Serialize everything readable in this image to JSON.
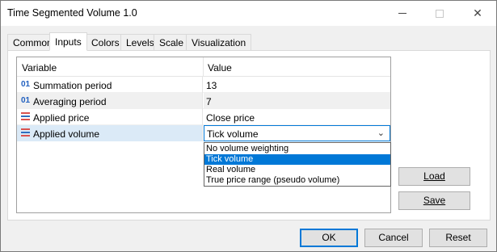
{
  "window": {
    "title": "Time Segmented Volume 1.0"
  },
  "tabs": [
    {
      "label": "Common"
    },
    {
      "label": "Inputs"
    },
    {
      "label": "Colors"
    },
    {
      "label": "Levels"
    },
    {
      "label": "Scale"
    },
    {
      "label": "Visualization"
    }
  ],
  "grid": {
    "col_variable": "Variable",
    "col_value": "Value",
    "rows": [
      {
        "icon": "01",
        "label": "Summation period",
        "value": "13"
      },
      {
        "icon": "01",
        "label": "Averaging period",
        "value": "7"
      },
      {
        "icon": "enum-list-icon",
        "label": "Applied price",
        "value": "Close price"
      },
      {
        "icon": "enum-list-icon",
        "label": "Applied volume",
        "value": "Tick volume"
      }
    ]
  },
  "dropdown": {
    "selected": "Tick volume",
    "options": [
      "No volume weighting",
      "Tick volume",
      "Real volume",
      "True price range (pseudo volume)"
    ]
  },
  "side_buttons": {
    "load": "Load",
    "save": "Save"
  },
  "footer": {
    "ok": "OK",
    "cancel": "Cancel",
    "reset": "Reset"
  },
  "colors": {
    "accent": "#0078d7",
    "selected_row": "#dbeaf7",
    "int_icon": "#1f5fbf"
  }
}
